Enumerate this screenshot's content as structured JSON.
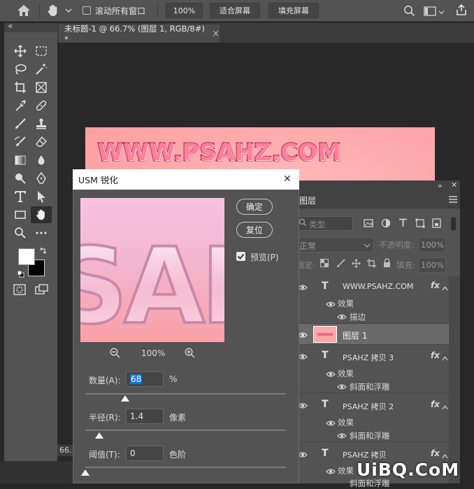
{
  "options_bar": {
    "scroll_all_label": "滚动所有窗口",
    "zoom_button": "100%",
    "fit_screen_button": "适合屏幕",
    "fill_screen_button": "填充屏幕"
  },
  "toolbar": {
    "collapse_glyph": "«"
  },
  "document": {
    "tab_title": "未标题-1 @ 66.7% (图层 1, RGB/8#) *",
    "tab_close": "×",
    "canvas_text": "WWW.PSAHZ.COM",
    "status_zoom": "66."
  },
  "dialog": {
    "title": "USM 锐化",
    "close_glyph": "✕",
    "ok_button": "确定",
    "reset_button": "复位",
    "preview_checkbox_label": "预览(P)",
    "preview_checked": true,
    "zoom_level": "100%",
    "preview_letters": "SAH",
    "amount": {
      "label": "数量(A):",
      "value": "68",
      "unit": "%",
      "slider_fraction": 0.2
    },
    "radius": {
      "label": "半径(R):",
      "value": "1.4",
      "unit": "像素",
      "slider_fraction": 0.07
    },
    "threshold": {
      "label": "阈值(T):",
      "value": "0",
      "unit": "色阶",
      "slider_fraction": 0.0
    }
  },
  "layers_panel": {
    "tab_label": "图层",
    "filter_placeholder": "类型",
    "blend_mode": "正常",
    "opacity_label": "不透明度:",
    "opacity_value": "100%",
    "lock_label": "锁定:",
    "fill_label": "填充:",
    "fill_value": "100%",
    "layers": [
      {
        "type": "text",
        "name": "WWW.PSAHZ.COM",
        "fx": "fx",
        "effects_label": "效果",
        "effects": [
          "描边"
        ]
      },
      {
        "type": "pixel",
        "name": "图层 1",
        "selected": true
      },
      {
        "type": "text",
        "name": "PSAHZ 拷贝 3",
        "fx": "fx",
        "effects_label": "效果",
        "effects": [
          "斜面和浮雕"
        ]
      },
      {
        "type": "text",
        "name": "PSAHZ 拷贝 2",
        "fx": "fx",
        "effects_label": "效果",
        "effects": [
          "斜面和浮雕"
        ]
      },
      {
        "type": "text",
        "name": "PSAHZ 拷贝",
        "fx": "fx",
        "effects_label": "效果",
        "effects": [
          "斜面和浮雕"
        ]
      }
    ]
  },
  "watermark": "UiBQ.CoM",
  "colors": {
    "panel": "#535353",
    "dark": "#282828",
    "accent_selection": "#1473e6",
    "canvas_pink": "#fda7a9"
  }
}
